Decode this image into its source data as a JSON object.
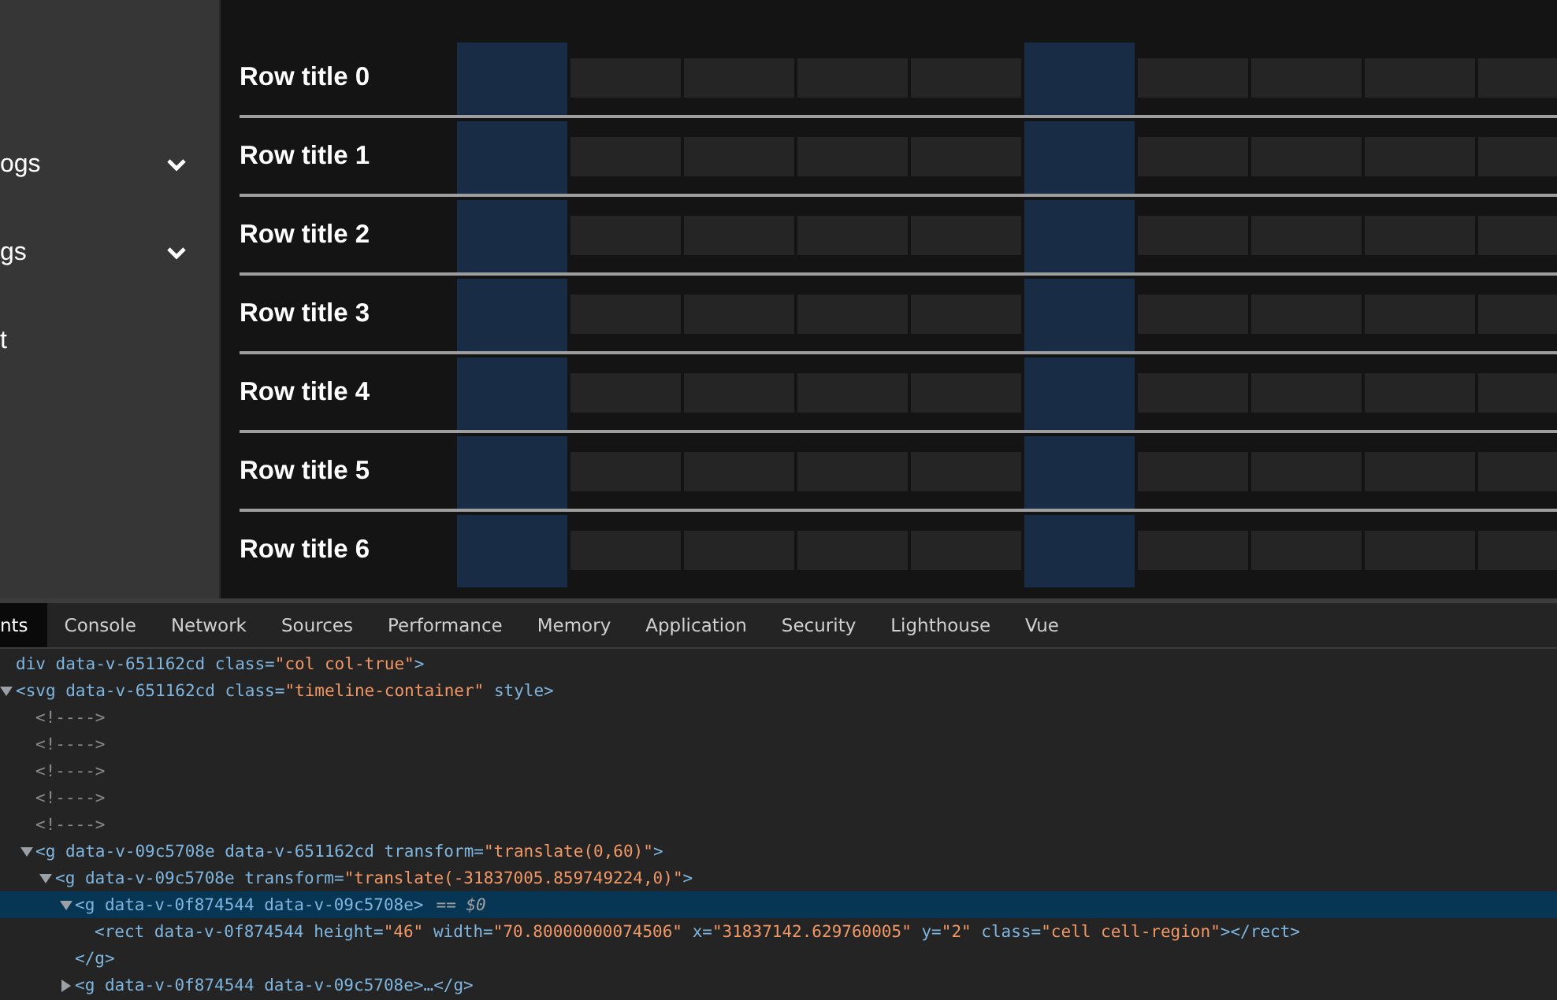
{
  "sidebar": {
    "items": [
      {
        "label": "ogs",
        "kind": "group",
        "expanded": false
      },
      {
        "label": "gs",
        "kind": "group",
        "expanded": false
      },
      {
        "label": "t",
        "kind": "link"
      }
    ]
  },
  "timeline": {
    "columns": [
      {
        "kind": "region"
      },
      {
        "kind": "slot"
      },
      {
        "kind": "slot"
      },
      {
        "kind": "slot"
      },
      {
        "kind": "slot"
      },
      {
        "kind": "region"
      },
      {
        "kind": "slot"
      },
      {
        "kind": "slot"
      },
      {
        "kind": "slot"
      },
      {
        "kind": "slot"
      }
    ],
    "rows": [
      {
        "title": "Row title 0"
      },
      {
        "title": "Row title 1"
      },
      {
        "title": "Row title 2"
      },
      {
        "title": "Row title 3"
      },
      {
        "title": "Row title 4"
      },
      {
        "title": "Row title 5"
      },
      {
        "title": "Row title 6"
      }
    ]
  },
  "devtools": {
    "tabs": [
      {
        "label": "nts",
        "selected": true
      },
      {
        "label": "Console",
        "selected": false
      },
      {
        "label": "Network",
        "selected": false
      },
      {
        "label": "Sources",
        "selected": false
      },
      {
        "label": "Performance",
        "selected": false
      },
      {
        "label": "Memory",
        "selected": false
      },
      {
        "label": "Application",
        "selected": false
      },
      {
        "label": "Security",
        "selected": false
      },
      {
        "label": "Lighthouse",
        "selected": false
      },
      {
        "label": "Vue",
        "selected": false
      }
    ],
    "dom_tree": [
      {
        "kind": "element",
        "text": "div data-v-651162cd class=\"col col-true\">"
      },
      {
        "kind": "element",
        "text": "<svg data-v-651162cd class=\"timeline-container\" style>",
        "expanded": true,
        "children": [
          {
            "kind": "comment",
            "text": "<!---->"
          },
          {
            "kind": "comment",
            "text": "<!---->"
          },
          {
            "kind": "comment",
            "text": "<!---->"
          },
          {
            "kind": "comment",
            "text": "<!---->"
          },
          {
            "kind": "comment",
            "text": "<!---->"
          },
          {
            "kind": "element",
            "text": "<g data-v-09c5708e data-v-651162cd transform=\"translate(0,60)\">",
            "expanded": true,
            "children": [
              {
                "kind": "element",
                "text": "<g data-v-09c5708e transform=\"translate(-31837005.859749224,0)\">",
                "expanded": true,
                "children": [
                  {
                    "kind": "element",
                    "text": "<g data-v-0f874544 data-v-09c5708e>",
                    "expanded": true,
                    "selected": true,
                    "marker": "== $0",
                    "closing": "</g>",
                    "children": [
                      {
                        "kind": "element",
                        "text": "<rect data-v-0f874544 height=\"46\" width=\"70.80000000074506\" x=\"31837142.629760005\" y=\"2\" class=\"cell cell-region\"></rect>"
                      }
                    ]
                  },
                  {
                    "kind": "element",
                    "text": "<g data-v-0f874544 data-v-09c5708e>…</g>",
                    "expanded": false,
                    "selected": false
                  }
                ]
              }
            ]
          }
        ]
      }
    ]
  }
}
